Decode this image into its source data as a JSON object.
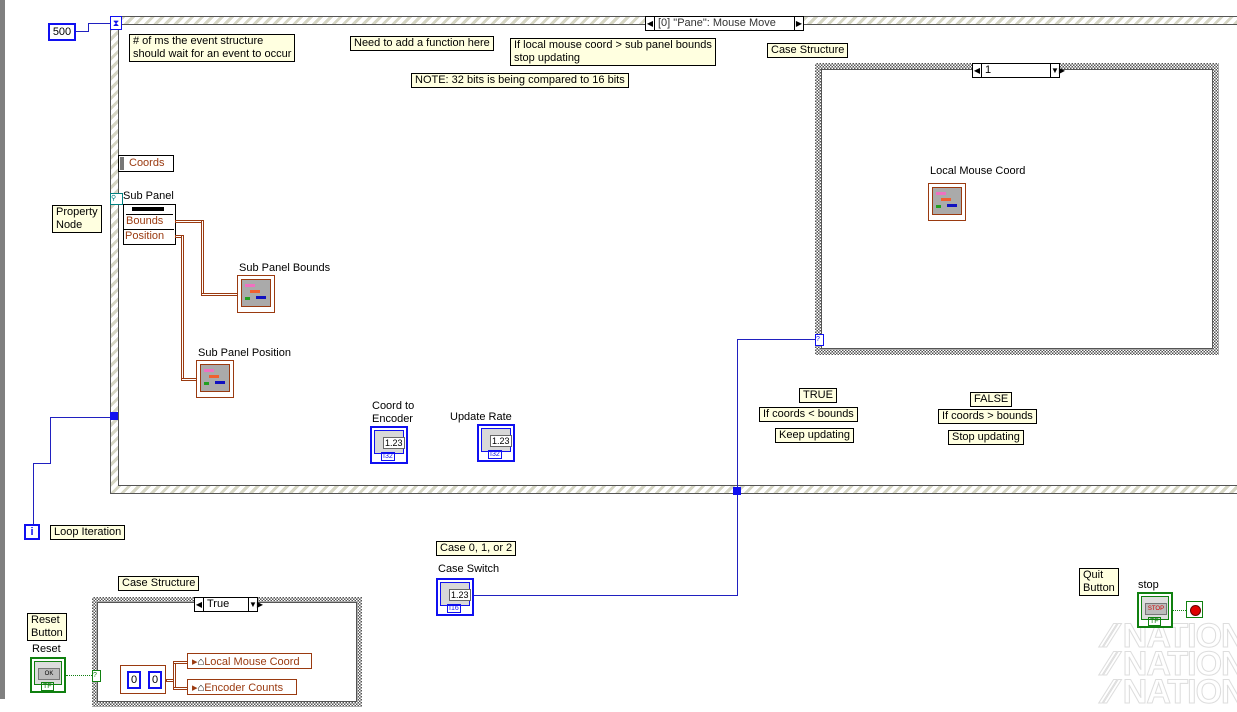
{
  "colors": {
    "int_wire": "#2020c0",
    "cluster_wire": "#9a3a10",
    "bool_wire": "#108010",
    "note_bg": "#ffffe0"
  },
  "timeout_constant": "500",
  "event_structure": {
    "selector": "[0] \"Pane\": Mouse Move"
  },
  "notes": {
    "timeout": "# of ms the event structure\nshould wait for an event to occur",
    "need_function": "Need to add a function here",
    "if_local": "If local mouse coord > sub panel bounds\nstop updating",
    "bits": "NOTE: 32 bits is being compared to 16 bits",
    "case_structure_top": "Case Structure",
    "property_node": "Property\nNode",
    "true": "TRUE",
    "if_less": "If coords < bounds",
    "keep": "Keep updating",
    "false": "FALSE",
    "if_greater": "If coords > bounds",
    "stop_upd": "Stop updating",
    "loop_iteration": "Loop Iteration",
    "case_012": "Case 0, 1,  or 2",
    "case_structure_bottom": "Case Structure",
    "reset_button": "Reset\nButton",
    "quit_button": "Quit\nButton"
  },
  "inner_case": {
    "selector": "1",
    "local_mouse_label": "Local Mouse Coord"
  },
  "coords_label": "Coords",
  "property_node": {
    "label": "Sub Panel",
    "props": [
      "Bounds",
      "Position"
    ]
  },
  "indicators": {
    "sub_panel_bounds": "Sub Panel Bounds",
    "sub_panel_position": "Sub Panel Position",
    "coord_to_encoder": "Coord to\nEncoder",
    "update_rate": "Update Rate",
    "case_switch": "Case Switch",
    "num_value": "1.23",
    "i32": "I32",
    "i16": "I16"
  },
  "loop_iter_terminal": "i",
  "bottom_case": {
    "selector": "True",
    "cluster_values": [
      "0",
      "0"
    ],
    "locals": [
      "Local Mouse Coord",
      "Encoder Counts"
    ]
  },
  "reset": {
    "label": "Reset",
    "button_text": "OK",
    "tf": "TF"
  },
  "stop": {
    "label": "stop",
    "button_text": "STOP",
    "tf": "TF"
  },
  "watermark": "NATIONAL"
}
